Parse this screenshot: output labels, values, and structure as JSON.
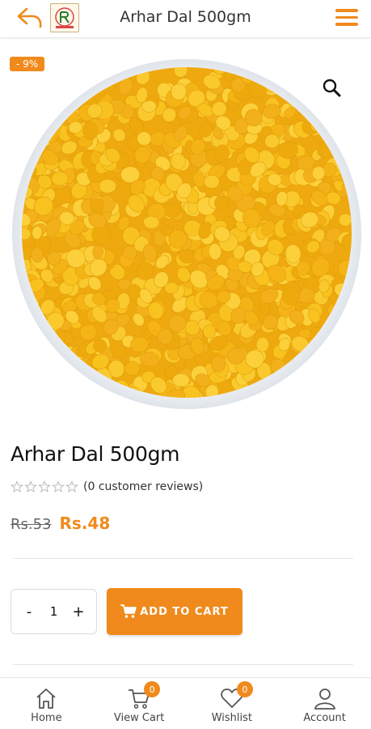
{
  "header": {
    "title": "Arhar Dal 500gm"
  },
  "product": {
    "discount": "- 9%",
    "name": "Arhar Dal 500gm",
    "rating": 0,
    "reviews_text": "(0 customer reviews)",
    "old_price": "Rs.53",
    "new_price": "Rs.48"
  },
  "quantity": {
    "minus": "-",
    "value": "1",
    "plus": "+"
  },
  "cart_button": {
    "label": "ADD TO CART",
    "icon": "cart-icon"
  },
  "bottom_nav": {
    "items": [
      {
        "label": "Home",
        "icon": "home-icon"
      },
      {
        "label": "View Cart",
        "icon": "cart-icon",
        "badge": "0"
      },
      {
        "label": "Wishlist",
        "icon": "heart-icon",
        "badge": "0"
      },
      {
        "label": "Account",
        "icon": "user-icon"
      }
    ]
  },
  "colors": {
    "accent": "#f08a1c",
    "lentil": "#f5b718"
  }
}
